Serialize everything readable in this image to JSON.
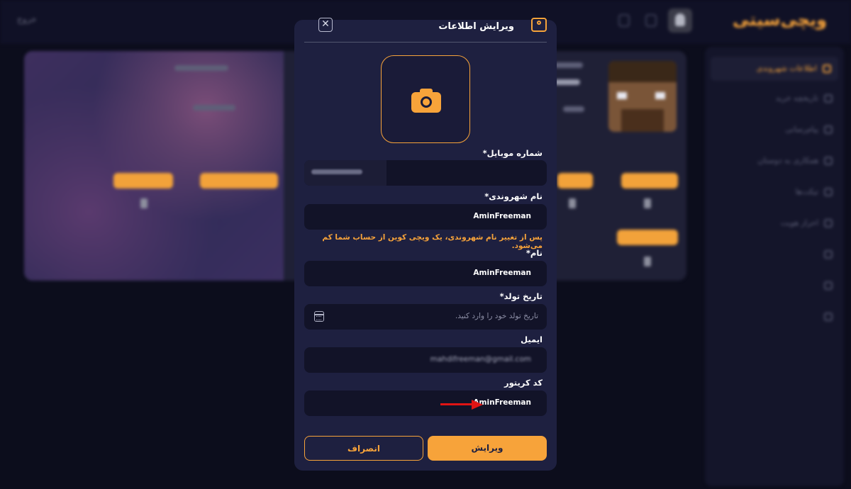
{
  "app": {
    "logo": "ویچی‌سیتی",
    "top_link": "خروج"
  },
  "sidebar": {
    "items": [
      {
        "label": "اطلاعات شهروندی",
        "active": true
      },
      {
        "label": "تاریخچه خرید",
        "active": false
      },
      {
        "label": "پیام‌رسانی",
        "active": false
      },
      {
        "label": "همکاری به دوستان",
        "active": false
      },
      {
        "label": "تیکت‌ها",
        "active": false
      },
      {
        "label": "احراز هویت",
        "active": false
      },
      {
        "label": "",
        "active": false
      },
      {
        "label": "",
        "active": false
      },
      {
        "label": "",
        "active": false
      }
    ]
  },
  "modal": {
    "title": "ویرایش اطلاعات",
    "close_symbol": "✕",
    "fields": {
      "mobile": {
        "label": "شماره موبایل*",
        "value": "09xxxxxxxxx"
      },
      "citizen_name": {
        "label": "نام شهروندی*",
        "value": "AminFreeman"
      },
      "citizen_warning": "پس از تغییر نام شهروندی، یک ویچی کوین از حساب شما کم می‌شود.",
      "name": {
        "label": "نام*",
        "value": "AminFreeman"
      },
      "birthdate": {
        "label": "تاریخ تولد*",
        "placeholder": "تاریخ تولد خود را وارد کنید."
      },
      "email": {
        "label": "ایمیل",
        "value": "mahdifreeman@gmail.com"
      },
      "creator_code": {
        "label": "کد کریتور",
        "value": "AminFreeman"
      }
    },
    "buttons": {
      "submit": "ویرایش",
      "cancel": "انصراف"
    }
  },
  "colors": {
    "accent": "#f7a33a",
    "modal_bg": "#1e2040",
    "field_bg": "#121328",
    "annotation_arrow": "#e01414"
  },
  "icons": [
    "user-card-icon",
    "close-icon",
    "camera-icon",
    "calendar-icon",
    "arrow-annotation"
  ]
}
